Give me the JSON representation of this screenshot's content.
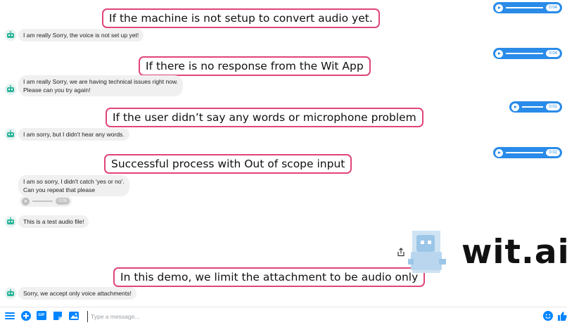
{
  "annotations": {
    "no_setup": "If the machine is not setup to convert audio yet.",
    "no_response": "If there is no response from the Wit App",
    "no_words": "If the user didn’t say any words or microphone problem",
    "out_of_scope": "Successful process with Out of scope input",
    "audio_only": "In this demo, we limit the attachment to be audio only"
  },
  "bot_messages": {
    "voice_not_setup": "I am really Sorry, the voice is not set up yet!",
    "technical_issues_line1": "I am really Sorry, we are having technical issues right now.",
    "technical_issues_line2": "Please can you try again!",
    "no_words": "I am sorry, but I didn't hear any words.",
    "didnt_catch_line1": "I am so sorry, I didn't catch 'yes or no'.",
    "didnt_catch_line2": "Can you repeat that please",
    "test_audio": "This is a test audio file!",
    "voice_only": "Sorry, we accept only voice attachments!"
  },
  "user_audio": {
    "clip1_duration": "0:04",
    "clip2_duration": "0:04",
    "clip3_duration": "0:01",
    "clip4_duration": "0:02"
  },
  "bot_audio": {
    "duration": "0:05"
  },
  "logo": {
    "text": "wit.ai"
  },
  "composer": {
    "placeholder": "Type a message...",
    "gif_label": "GIF"
  },
  "colors": {
    "messenger_blue": "#2a8be8",
    "annotation_border": "#e0457b",
    "bot_bubble": "#f1f0f0",
    "bot_avatar": "#2bb59a"
  }
}
